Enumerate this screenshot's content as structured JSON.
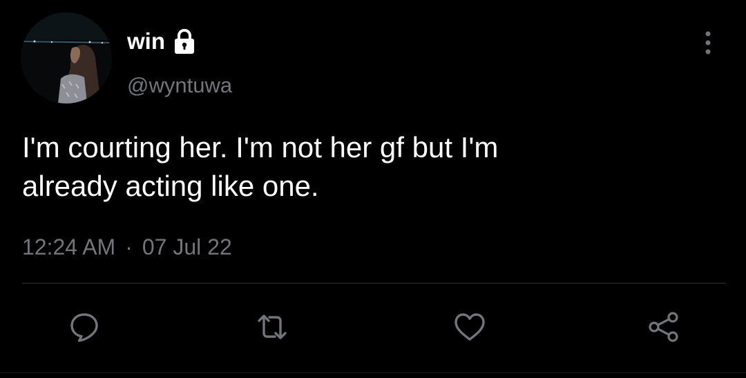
{
  "tweet": {
    "display_name": "win",
    "handle": "@wyntuwa",
    "text": "I'm courting her. I'm not her gf but I'm\nalready acting like one.",
    "time": "12:24 AM",
    "separator": "·",
    "date": "07 Jul 22"
  },
  "icons": {
    "account": "lock-icon",
    "menu": "more-vertical-icon",
    "reply": "reply-icon",
    "retweet": "retweet-icon",
    "like": "heart-icon",
    "share": "share-icon"
  },
  "colors": {
    "background": "#000000",
    "text_primary": "#ffffff",
    "text_secondary": "#71767b",
    "divider": "#2f3336",
    "icon": "#71767b"
  }
}
